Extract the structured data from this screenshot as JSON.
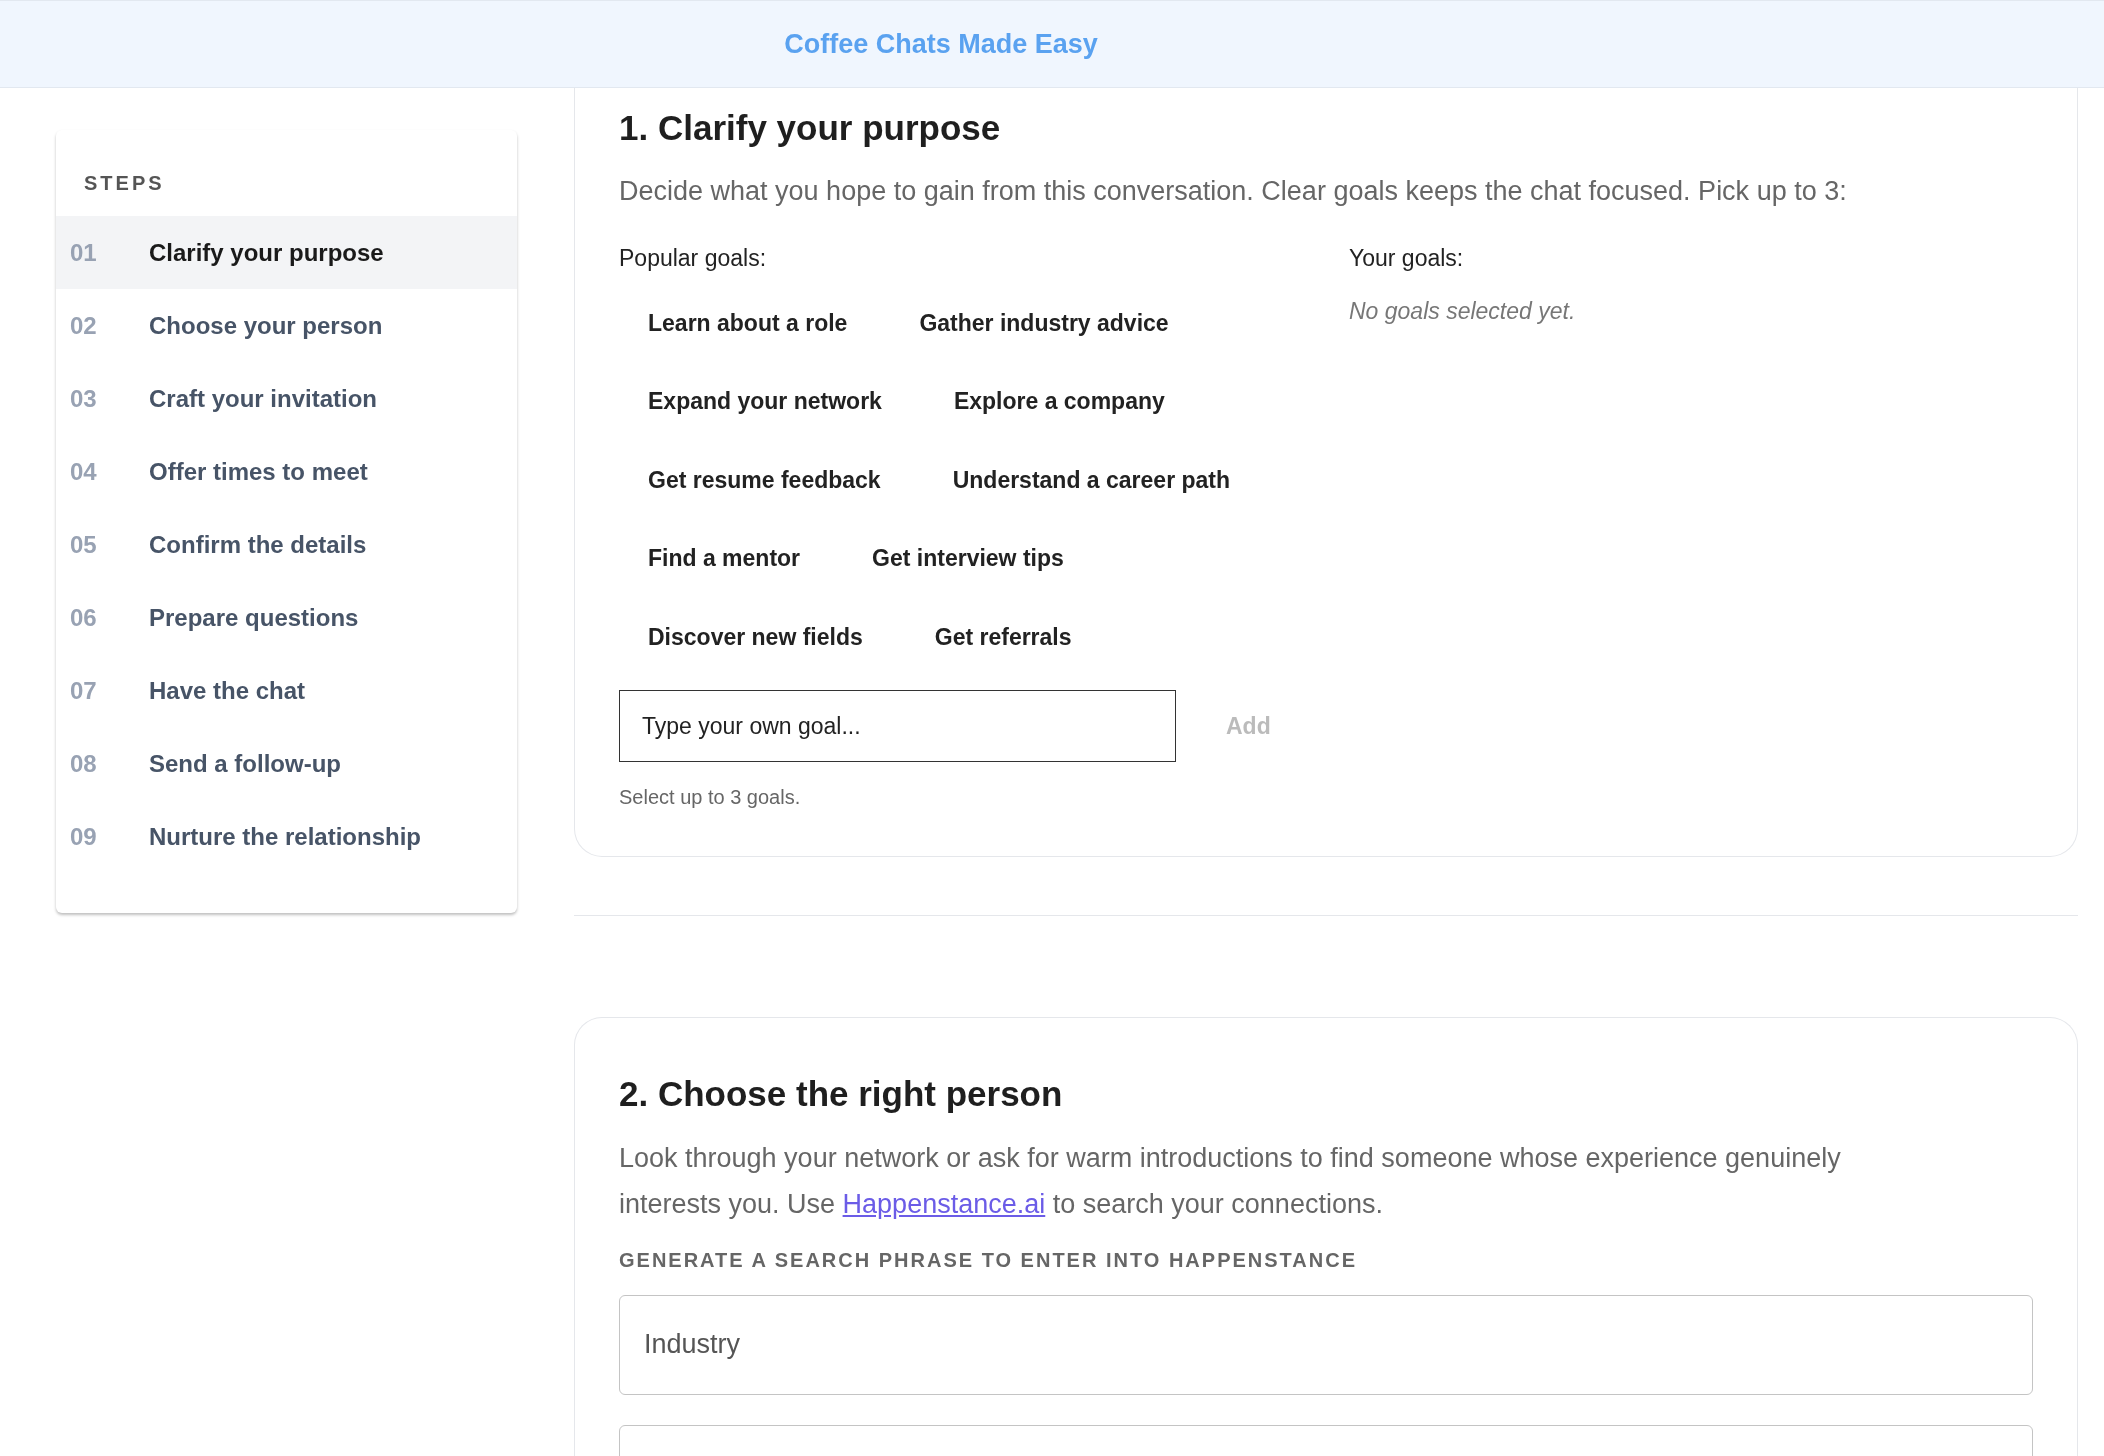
{
  "header": {
    "title": "Coffee Chats Made Easy"
  },
  "sidebar": {
    "heading": "STEPS",
    "items": [
      {
        "number": "01",
        "label": "Clarify your purpose",
        "selected": true
      },
      {
        "number": "02",
        "label": "Choose your person",
        "selected": false
      },
      {
        "number": "03",
        "label": "Craft your invitation",
        "selected": false
      },
      {
        "number": "04",
        "label": "Offer times to meet",
        "selected": false
      },
      {
        "number": "05",
        "label": "Confirm the details",
        "selected": false
      },
      {
        "number": "06",
        "label": "Prepare questions",
        "selected": false
      },
      {
        "number": "07",
        "label": "Have the chat",
        "selected": false
      },
      {
        "number": "08",
        "label": "Send a follow-up",
        "selected": false
      },
      {
        "number": "09",
        "label": "Nurture the relationship",
        "selected": false
      }
    ]
  },
  "section_1": {
    "title": "1. Clarify your purpose",
    "description": "Decide what you hope to gain from this conversation. Clear goals keeps the chat focused. Pick up to 3:",
    "popular_label": "Popular goals:",
    "popular_goals": [
      "Learn about a role",
      "Gather industry advice",
      "Expand your network",
      "Explore a company",
      "Get resume feedback",
      "Understand a career path",
      "Find a mentor",
      "Get interview tips",
      "Discover new fields",
      "Get referrals"
    ],
    "your_goals_label": "Your goals:",
    "your_goals_empty": "No goals selected yet.",
    "custom_goal": {
      "placeholder": "Type your own goal..."
    },
    "add_button": {
      "label": "Add",
      "disabled": true
    },
    "hint": "Select up to 3 goals."
  },
  "section_2": {
    "title": "2. Choose the right person",
    "description_before": "Look through your network or ask for warm introductions to find someone whose experience genuinely interests you. Use ",
    "link": "Happenstance.ai",
    "description_after": " to search your connections.",
    "field_label": "GENERATE A SEARCH PHRASE TO ENTER INTO HAPPENSTANCE",
    "industry_field": {
      "placeholder": "Industry"
    }
  }
}
